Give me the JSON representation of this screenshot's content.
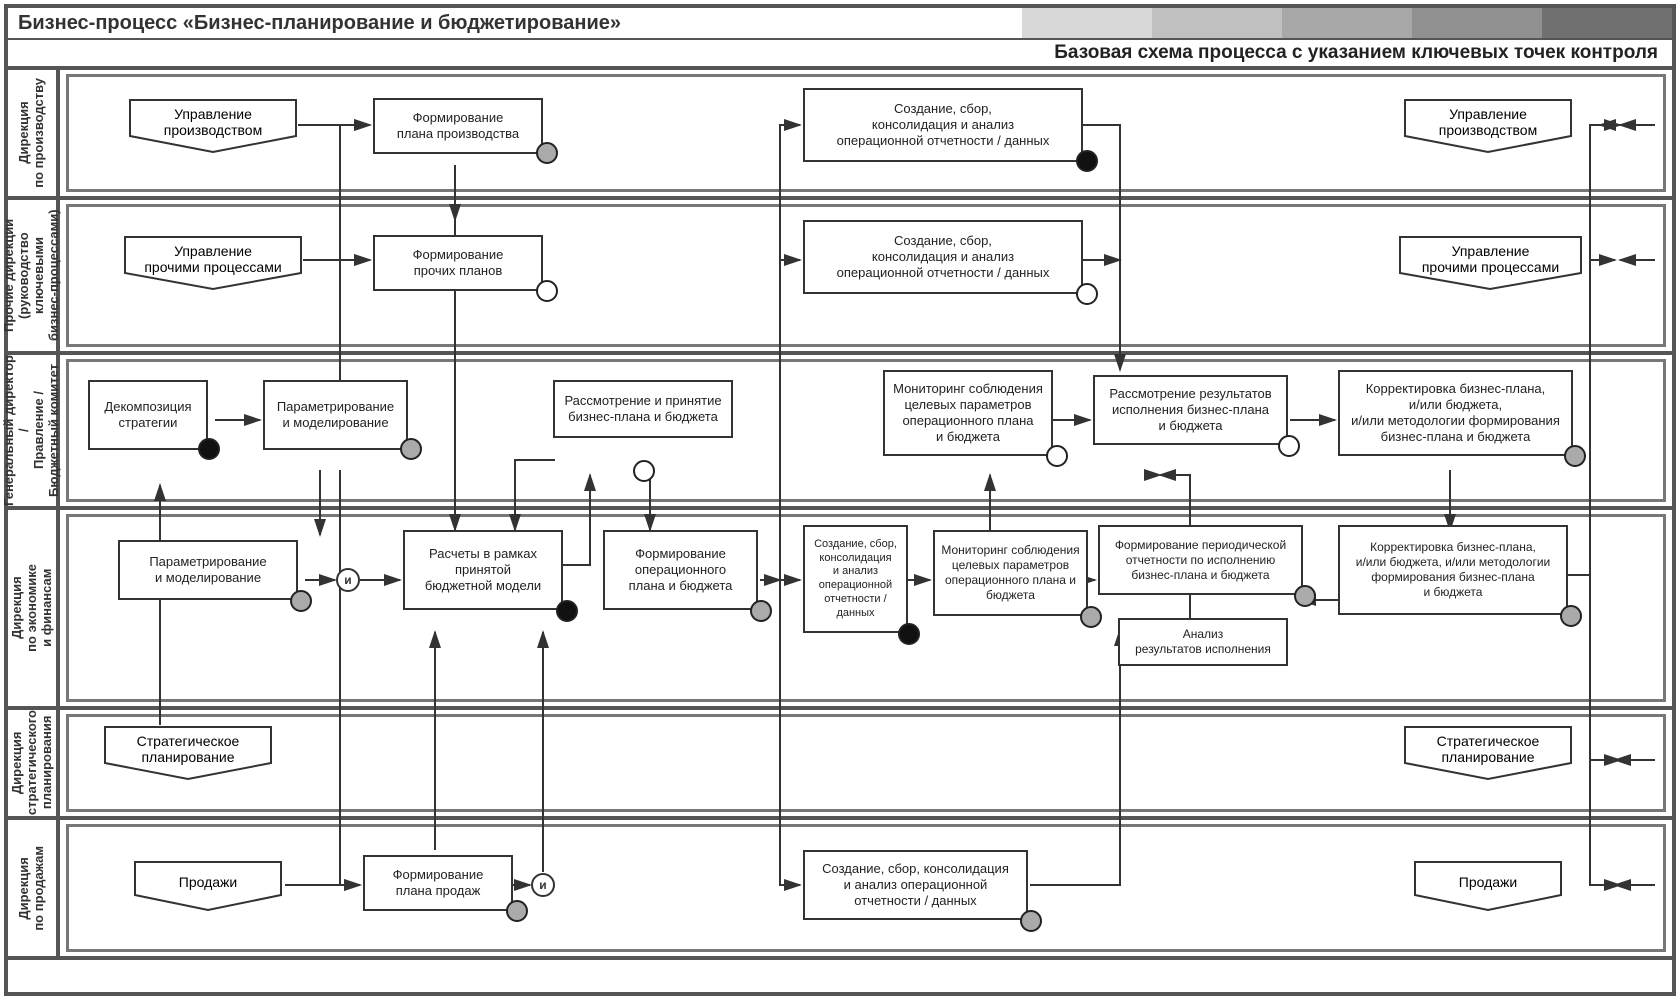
{
  "title": "Бизнес-процесс «Бизнес-планирование и бюджетирование»",
  "subtitle": "Базовая схема процесса с указанием ключевых точек контроля",
  "lanes": {
    "l1": "Дирекция\nпо производству",
    "l2": "Прочие дирекции\n(руководство ключевыми\nбизнес-процессами)",
    "l3": "Генеральный директор /\nПравление /\nБюджетный комитет",
    "l4": "Дирекция\nпо экономике\nи финансам",
    "l5": "Дирекция\nстратегического\nпланирования",
    "l6": "Дирекция\nпо продажам"
  },
  "pent": {
    "p_prod_l": "Управление\nпроизводством",
    "p_prod_r": "Управление\nпроизводством",
    "p_other_l": "Управление\nпрочими процессами",
    "p_other_r": "Управление\nпрочими процессами",
    "p_strat_l": "Стратегическое\nпланирование",
    "p_strat_r": "Стратегическое\nпланирование",
    "p_sales_l": "Продажи",
    "p_sales_r": "Продажи"
  },
  "box": {
    "b_form_prod": "Формирование\nплана производства",
    "b_form_other": "Формирование\nпрочих планов",
    "b_cons1": "Создание, сбор,\nконсолидация и анализ\nоперационной отчетности / данных",
    "b_cons2": "Создание, сбор,\nконсолидация и анализ\nоперационной отчетности / данных",
    "b_decomp": "Декомпозиция\nстратегии",
    "b_param1": "Параметрирование\nи моделирование",
    "b_review_bp": "Рассмотрение и принятие\nбизнес-плана и бюджета",
    "b_monit_ceo": "Мониторинг соблюдения\nцелевых параметров\nоперационного плана\nи бюджета",
    "b_review_res": "Рассмотрение результатов\nисполнения бизнес-плана\nи бюджета",
    "b_korr_ceo": "Корректировка бизнес-плана,\nи/или бюджета,\nи/или методологии формирования\nбизнес-плана и бюджета",
    "b_param2": "Параметрирование\nи моделирование",
    "b_calc": "Расчеты в рамках\nпринятой\nбюджетной модели",
    "b_form_op": "Формирование\nоперационного\nплана и бюджета",
    "b_cons_fin": "Создание, сбор,\nконсолидация\nи анализ\nоперационной\nотчетности /\nданных",
    "b_monit_fin": "Мониторинг соблюдения\nцелевых параметров\nоперационного плана и\nбюджета",
    "b_form_rep": "Формирование периодической\nотчетности по исполнению\nбизнес-плана и бюджета",
    "b_anal": "Анализ\nрезультатов исполнения",
    "b_korr_fin": "Корректировка бизнес-плана,\nи/или бюджета, и/или методологии\nформирования бизнес-плана\nи бюджета",
    "b_form_sales": "Формирование\nплана продаж",
    "b_cons_sales": "Создание, сбор, консолидация\nи анализ операционной\nотчетности / данных"
  },
  "gate": {
    "and": "и"
  }
}
